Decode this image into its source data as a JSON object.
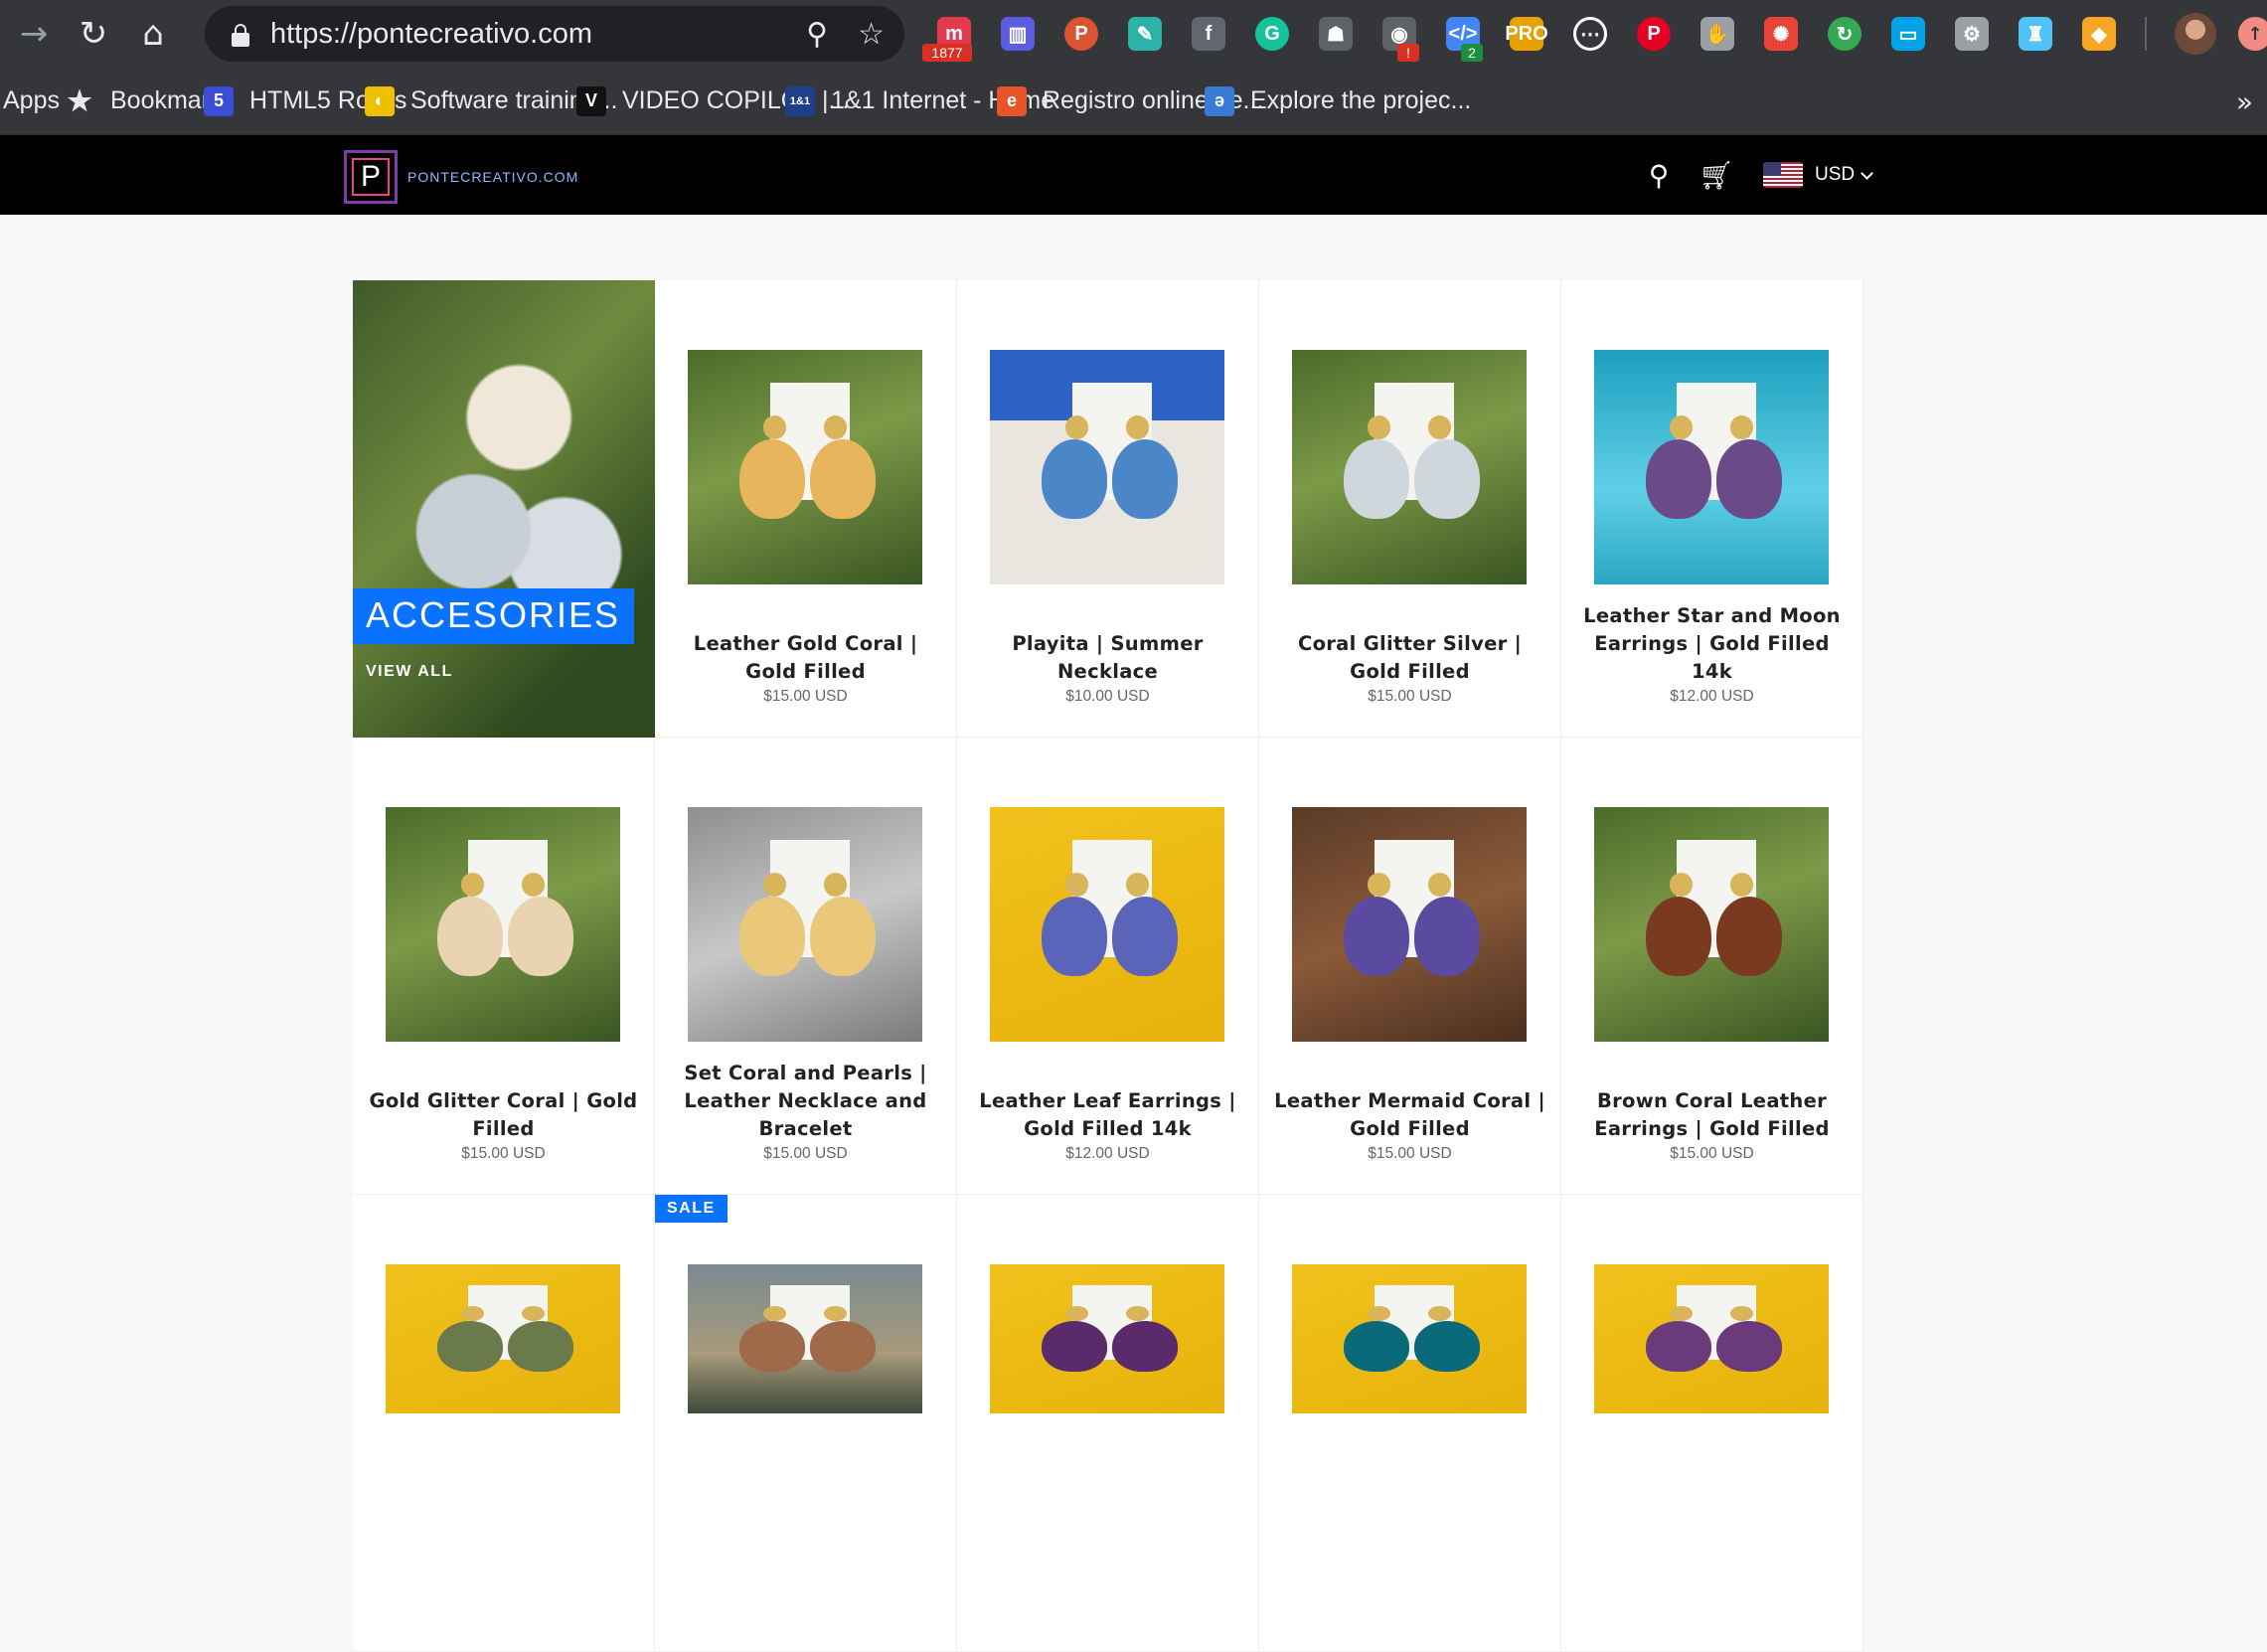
{
  "browser": {
    "url": "https://pontecreativo.com",
    "extensions": [
      {
        "name": "momentum",
        "label": "m",
        "color": "#e53950",
        "badge": "1877"
      },
      {
        "name": "columns",
        "label": "▥",
        "color": "#5b5ce2",
        "badge": ""
      },
      {
        "name": "producthunt",
        "label": "P",
        "color": "#da552f",
        "badge": ""
      },
      {
        "name": "feather",
        "label": "✎",
        "color": "#2ab3a6",
        "badge": ""
      },
      {
        "name": "facebook",
        "label": "f",
        "color": "#606770",
        "badge": ""
      },
      {
        "name": "grammarly",
        "label": "G",
        "color": "#15c39a",
        "badge": ""
      },
      {
        "name": "spy",
        "label": "☗",
        "color": "#5f6368",
        "badge": ""
      },
      {
        "name": "camera",
        "label": "◉",
        "color": "#5f6368",
        "badge": "!"
      },
      {
        "name": "devtools",
        "label": "</>",
        "color": "#4285f4",
        "badge": "2"
      },
      {
        "name": "pro",
        "label": "PRO",
        "color": "#e8a200",
        "badge": ""
      },
      {
        "name": "dots",
        "label": "⋯",
        "color": "#ffffff",
        "badge": ""
      },
      {
        "name": "pinterest",
        "label": "P",
        "color": "#e60023",
        "badge": ""
      },
      {
        "name": "hand",
        "label": "✋",
        "color": "#9aa0a6",
        "badge": ""
      },
      {
        "name": "colorwheel",
        "label": "✺",
        "color": "#ea4335",
        "badge": ""
      },
      {
        "name": "refresh",
        "label": "↻",
        "color": "#34a853",
        "badge": ""
      },
      {
        "name": "monitor",
        "label": "▭",
        "color": "#00a2e8",
        "badge": ""
      },
      {
        "name": "settings",
        "label": "⚙",
        "color": "#9aa0a6",
        "badge": ""
      },
      {
        "name": "figure",
        "label": "♜",
        "color": "#4fc3f7",
        "badge": ""
      },
      {
        "name": "tag",
        "label": "◆",
        "color": "#f6a623",
        "badge": ""
      }
    ]
  },
  "bookmarks": [
    {
      "label": "Apps",
      "icon": "grid-icon",
      "color": ""
    },
    {
      "label": "Bookmarks",
      "icon": "star-icon",
      "color": ""
    },
    {
      "label": "HTML5 Rocks",
      "icon": "html5-icon",
      "color": "#3b4ed6"
    },
    {
      "label": "Software training...",
      "icon": "lynda-icon",
      "color": "#f0c000"
    },
    {
      "label": "VIDEO COPILOT |...",
      "icon": "videocopilot-icon",
      "color": "#111111"
    },
    {
      "label": "1&1 Internet - Home",
      "icon": "ionos-icon",
      "color": "#1f3f8a"
    },
    {
      "label": "Registro online de...",
      "icon": "registro-icon",
      "color": "#e8542a"
    },
    {
      "label": "Explore the projec...",
      "icon": "explore-icon",
      "color": "#3a7bd5"
    }
  ],
  "site": {
    "logo_letter": "P",
    "logo_text": "PONTECREATIVO.COM",
    "currency": "USD"
  },
  "collection": {
    "title": "ACCESORIES",
    "link": "VIEW ALL"
  },
  "products": [
    {
      "name": "Leather Gold Coral | Gold Filled",
      "price": "$15.00 USD",
      "bg": "grass",
      "ear": "#e7b55b"
    },
    {
      "name": "Playita | Summer Necklace",
      "price": "$10.00 USD",
      "bg": "sand",
      "ear": "#4a86c8"
    },
    {
      "name": "Coral Glitter Silver | Gold Filled",
      "price": "$15.00 USD",
      "bg": "grass",
      "ear": "#cfd6dc"
    },
    {
      "name": "Leather Star and Moon Earrings | Gold Filled 14k",
      "price": "$12.00 USD",
      "bg": "pool",
      "ear": "#6b4a8a"
    },
    {
      "name": "Gold Glitter Coral | Gold Filled",
      "price": "$15.00 USD",
      "bg": "grass",
      "ear": "#e9d3b0"
    },
    {
      "name": "Set Coral and Pearls | Leather Necklace and Bracelet",
      "price": "$15.00 USD",
      "bg": "stone",
      "ear": "#e9c87a"
    },
    {
      "name": "Leather Leaf Earrings | Gold Filled 14k",
      "price": "$12.00 USD",
      "bg": "yellow",
      "ear": "#5a64b8"
    },
    {
      "name": "Leather Mermaid Coral | Gold Filled",
      "price": "$15.00 USD",
      "bg": "wood",
      "ear": "#5a4aa0"
    },
    {
      "name": "Brown Coral Leather Earrings | Gold Filled",
      "price": "$15.00 USD",
      "bg": "grass",
      "ear": "#7a3a22"
    }
  ],
  "row3": [
    {
      "bg": "yellow",
      "ear": "#6a7a4a",
      "sale": ""
    },
    {
      "bg": "mixed",
      "ear": "#a06a4a",
      "sale": "SALE"
    },
    {
      "bg": "yellow",
      "ear": "#5a2a6a",
      "sale": ""
    },
    {
      "bg": "yellow",
      "ear": "#0a6a7a",
      "sale": ""
    },
    {
      "bg": "yellow",
      "ear": "#6a3a7a",
      "sale": ""
    }
  ]
}
